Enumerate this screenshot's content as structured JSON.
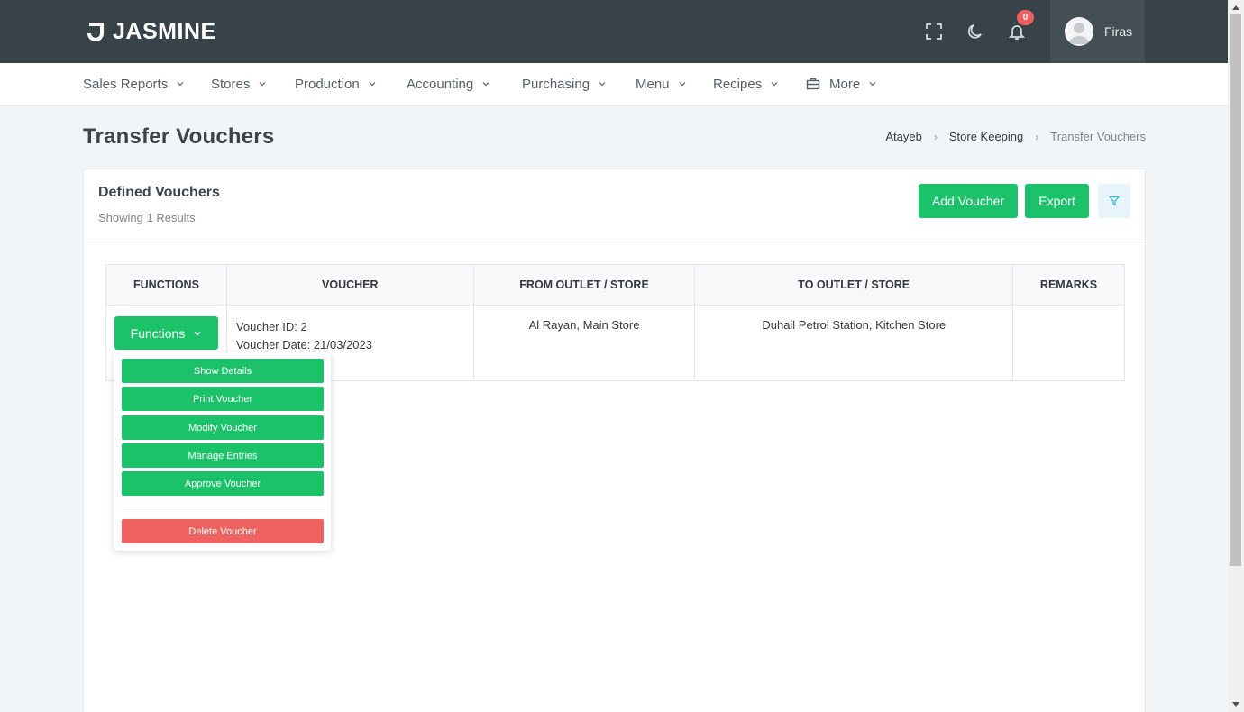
{
  "app": {
    "name": "JASMINE"
  },
  "header": {
    "notification_count": "0",
    "user_name": "Firas"
  },
  "menu": [
    {
      "label": "Sales Reports"
    },
    {
      "label": "Stores"
    },
    {
      "label": "Production"
    },
    {
      "label": "Accounting"
    },
    {
      "label": "Purchasing"
    },
    {
      "label": "Menu"
    },
    {
      "label": "Recipes"
    },
    {
      "label": "More"
    }
  ],
  "page": {
    "title": "Transfer Vouchers"
  },
  "breadcrumb": [
    "Atayeb",
    "Store Keeping",
    "Transfer Vouchers"
  ],
  "card": {
    "title": "Defined Vouchers",
    "subtitle": "Showing 1 Results",
    "add_label": "Add Voucher",
    "export_label": "Export"
  },
  "table": {
    "headers": [
      "FUNCTIONS",
      "VOUCHER",
      "FROM OUTLET / STORE",
      "TO OUTLET / STORE",
      "REMARKS"
    ],
    "rows": [
      {
        "functions_label": "Functions",
        "voucher_id": "Voucher ID: 2",
        "voucher_date": "Voucher Date: 21/03/2023",
        "from": "Al Rayan, Main Store",
        "to": "Duhail Petrol Station, Kitchen Store",
        "remarks": ""
      }
    ]
  },
  "dropdown": {
    "items": [
      "Show Details",
      "Print Voucher",
      "Modify Voucher",
      "Manage Entries",
      "Approve Voucher"
    ],
    "danger": "Delete Voucher"
  },
  "colors": {
    "topbar": "#374249",
    "primary": "#1bc26a",
    "danger": "#ee6262"
  }
}
